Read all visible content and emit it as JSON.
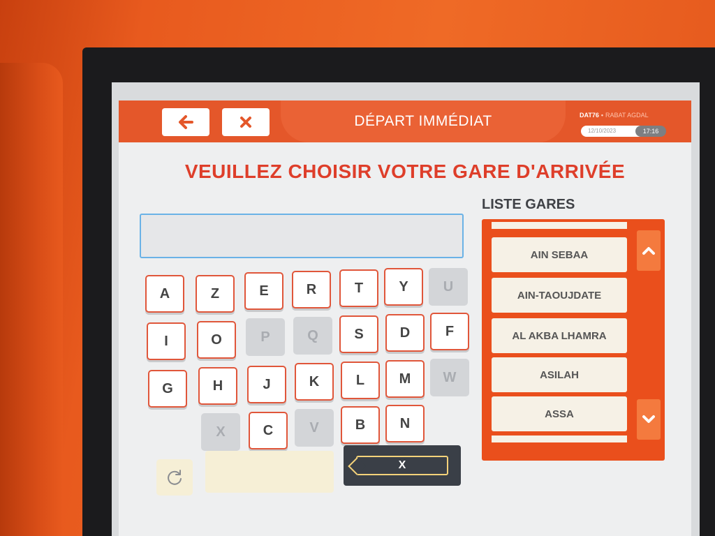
{
  "header": {
    "title": "DÉPART IMMÉDIAT",
    "station_code": "DAT76",
    "station_name": "RABAT AGDAL",
    "date": "12/10/2023",
    "time": "17:16"
  },
  "prompt": "VEUILLEZ CHOISIR VOTRE GARE D'ARRIVÉE",
  "search": {
    "value": ""
  },
  "keyboard": {
    "keys": [
      {
        "label": "A",
        "enabled": true
      },
      {
        "label": "Z",
        "enabled": true
      },
      {
        "label": "E",
        "enabled": true
      },
      {
        "label": "R",
        "enabled": true
      },
      {
        "label": "T",
        "enabled": true
      },
      {
        "label": "Y",
        "enabled": true
      },
      {
        "label": "U",
        "enabled": false
      },
      {
        "label": "I",
        "enabled": true
      },
      {
        "label": "O",
        "enabled": true
      },
      {
        "label": "P",
        "enabled": false
      },
      {
        "label": "Q",
        "enabled": false
      },
      {
        "label": "S",
        "enabled": true
      },
      {
        "label": "D",
        "enabled": true
      },
      {
        "label": "F",
        "enabled": true
      },
      {
        "label": "G",
        "enabled": true
      },
      {
        "label": "H",
        "enabled": true
      },
      {
        "label": "J",
        "enabled": true
      },
      {
        "label": "K",
        "enabled": true
      },
      {
        "label": "L",
        "enabled": true
      },
      {
        "label": "M",
        "enabled": true
      },
      {
        "label": "W",
        "enabled": false
      },
      {
        "label": "X",
        "enabled": false
      },
      {
        "label": "C",
        "enabled": true
      },
      {
        "label": "V",
        "enabled": false
      },
      {
        "label": "B",
        "enabled": true
      },
      {
        "label": "N",
        "enabled": true
      }
    ],
    "backspace_label": "X"
  },
  "station_list": {
    "title": "LISTE GARES",
    "items": [
      "AIN SEBAA",
      "AIN-TAOUJDATE",
      "AL AKBA LHAMRA",
      "ASILAH",
      "ASSA"
    ]
  },
  "colors": {
    "accent": "#e4572a",
    "prompt_red": "#de3e2a",
    "list_panel": "#ea4f1c",
    "kiosk_orange": "#e85a1e"
  },
  "icons": {
    "back": "arrow-left-icon",
    "close": "close-icon",
    "refresh": "refresh-icon",
    "scroll_up": "chevron-up-icon",
    "scroll_down": "chevron-down-icon"
  }
}
